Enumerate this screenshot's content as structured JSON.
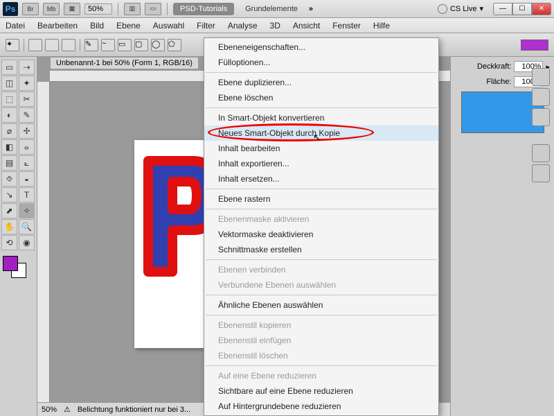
{
  "titlebar": {
    "logo": "Ps",
    "zoom": "50%",
    "tab1": "PSD-Tutorials",
    "tab2": "Grundelemente",
    "cslive": "CS Live",
    "chevron": "»"
  },
  "menubar": [
    "Datei",
    "Bearbeiten",
    "Bild",
    "Ebene",
    "Auswahl",
    "Filter",
    "Analyse",
    "3D",
    "Ansicht",
    "Fenster",
    "Hilfe"
  ],
  "doc_tab": "Unbenannt-1 bei 50% (Form 1, RGB/16)",
  "panels": {
    "opacity_label": "Deckkraft:",
    "opacity_val": "100%",
    "fill_label": "Fläche:",
    "fill_val": "100%"
  },
  "status": {
    "zoom": "50%",
    "hint": "Belichtung funktioniert nur bei 3..."
  },
  "colors": {
    "opt_swatch": "#b030d0",
    "fg": "#a020c0",
    "layer_thumb": "#3498e8"
  },
  "context_menu": [
    {
      "label": "Ebeneneigenschaften...",
      "enabled": true
    },
    {
      "label": "Fülloptionen...",
      "enabled": true
    },
    {
      "sep": true
    },
    {
      "label": "Ebene duplizieren...",
      "enabled": true
    },
    {
      "label": "Ebene löschen",
      "enabled": true
    },
    {
      "sep": true
    },
    {
      "label": "In Smart-Objekt konvertieren",
      "enabled": true
    },
    {
      "label": "Neues Smart-Objekt durch Kopie",
      "enabled": true,
      "hover": true,
      "highlighted": true
    },
    {
      "label": "Inhalt bearbeiten",
      "enabled": true
    },
    {
      "label": "Inhalt exportieren...",
      "enabled": true
    },
    {
      "label": "Inhalt ersetzen...",
      "enabled": true
    },
    {
      "sep": true
    },
    {
      "label": "Ebene rastern",
      "enabled": true
    },
    {
      "sep": true
    },
    {
      "label": "Ebenenmaske aktivieren",
      "enabled": false
    },
    {
      "label": "Vektormaske deaktivieren",
      "enabled": true
    },
    {
      "label": "Schnittmaske erstellen",
      "enabled": true
    },
    {
      "sep": true
    },
    {
      "label": "Ebenen verbinden",
      "enabled": false
    },
    {
      "label": "Verbundene Ebenen auswählen",
      "enabled": false
    },
    {
      "sep": true
    },
    {
      "label": "Ähnliche Ebenen auswählen",
      "enabled": true
    },
    {
      "sep": true
    },
    {
      "label": "Ebenenstil kopieren",
      "enabled": false
    },
    {
      "label": "Ebenenstil einfügen",
      "enabled": false
    },
    {
      "label": "Ebenenstil löschen",
      "enabled": false
    },
    {
      "sep": true
    },
    {
      "label": "Auf eine Ebene reduzieren",
      "enabled": false
    },
    {
      "label": "Sichtbare auf eine Ebene reduzieren",
      "enabled": true
    },
    {
      "label": "Auf Hintergrundebene reduzieren",
      "enabled": true
    }
  ],
  "tool_icons": [
    "▭",
    "⇢",
    "◫",
    "✦",
    "⬚",
    "✂",
    "◐",
    "✎",
    "⌀",
    "✢",
    "◧",
    "⦵",
    "▤",
    "⟀",
    "⯑",
    "◒",
    "↘",
    "T",
    "⬈",
    "✧",
    "✋",
    "🔍",
    "⟲",
    "◉"
  ]
}
